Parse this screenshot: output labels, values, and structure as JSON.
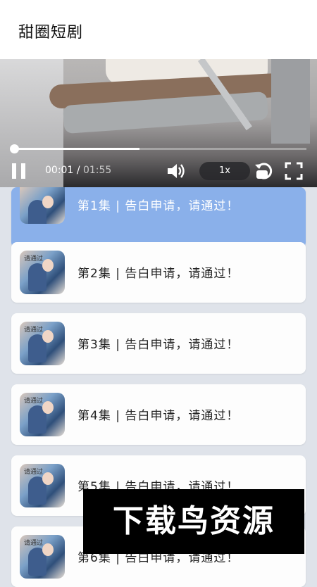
{
  "app": {
    "title": "甜圈短剧"
  },
  "player": {
    "current_time": "00:01",
    "separator": "/",
    "duration": "01:55",
    "speed_label": "1x",
    "progress_fraction": 0.43,
    "icons": {
      "pause": "pause-icon",
      "volume": "volume-icon",
      "replay": "replay-icon",
      "fullscreen": "fullscreen-icon"
    }
  },
  "episodes": [
    {
      "label": "第1集 | 告白申请，请通过！",
      "active": true
    },
    {
      "label": "第2集 | 告白申请，请通过！",
      "active": false
    },
    {
      "label": "第3集 | 告白申请，请通过！",
      "active": false
    },
    {
      "label": "第4集 | 告白申请，请通过！",
      "active": false
    },
    {
      "label": "第5集 | 告白申请，请通过！",
      "active": false
    },
    {
      "label": "第6集 | 告白申请，请通过！",
      "active": false
    }
  ],
  "thumbnail_caption": "请通过",
  "watermark": {
    "text": "下载鸟资源"
  },
  "colors": {
    "active_item": "#8ab0ea",
    "background": "#dfe3ea"
  }
}
